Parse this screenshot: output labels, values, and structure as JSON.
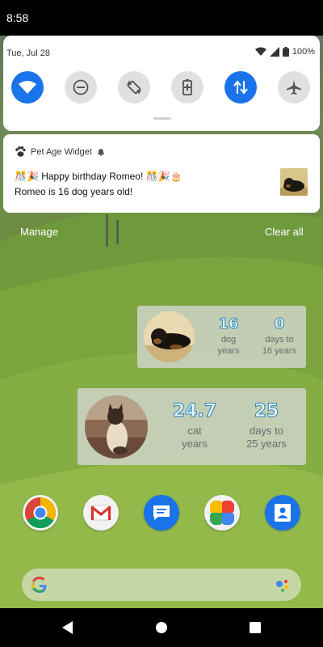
{
  "status_bar": {
    "time": "8:58"
  },
  "quick_settings": {
    "date": "Tue, Jul 28",
    "battery_percent": "100%",
    "tiles": [
      {
        "name": "wifi-icon",
        "active": true
      },
      {
        "name": "do-not-disturb-icon",
        "active": false
      },
      {
        "name": "auto-rotate-icon",
        "active": false
      },
      {
        "name": "battery-saver-icon",
        "active": false
      },
      {
        "name": "mobile-data-icon",
        "active": true
      },
      {
        "name": "airplane-mode-icon",
        "active": false
      }
    ]
  },
  "notification": {
    "app_name": "Pet Age Widget",
    "line1": "🎊🎉 Happy birthday Romeo! 🎊🎉🎂",
    "line2": "Romeo is 16 dog years old!"
  },
  "actions": {
    "manage": "Manage",
    "clear_all": "Clear all"
  },
  "dog_widget": {
    "age_value": "16",
    "age_label": "dog\nyears",
    "days_value": "0",
    "days_label": "days to\n16 years"
  },
  "cat_widget": {
    "age_value": "24.7",
    "age_label": "cat\nyears",
    "days_value": "25",
    "days_label": "days to\n25 years"
  },
  "dock_apps": [
    "Chrome",
    "Gmail",
    "Messages",
    "Photos",
    "Contacts"
  ],
  "colors": {
    "accent": "#1a73e8",
    "widget_number_outline": "#2a86b8"
  }
}
